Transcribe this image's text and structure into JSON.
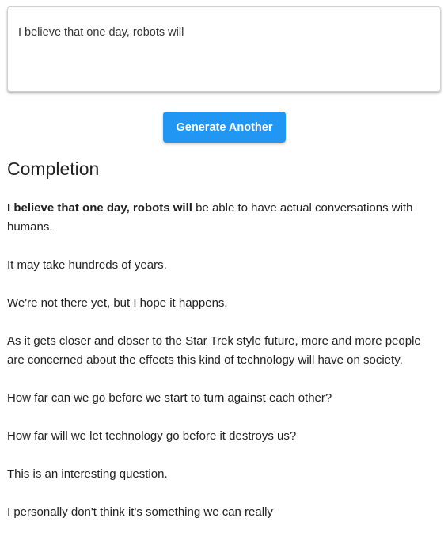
{
  "prompt": {
    "value": "I believe that one day, robots will"
  },
  "generate_button": {
    "label": "Generate Another",
    "color": "#2196f3"
  },
  "completion": {
    "heading": "Completion",
    "prompt_echo": "I believe that one day, robots will",
    "first_continuation": " be able to have actual conversations with humans.",
    "paragraphs": [
      "It may take hundreds of years.",
      "We're not there yet, but I hope it happens.",
      "As it gets closer and closer to the Star Trek style future, more and more people are concerned about the effects this kind of technology will have on society.",
      "How far can we go before we start to turn against each other?",
      "How far will we let technology go before it destroys us?",
      "This is an interesting question.",
      "I personally don't think it's something we can really"
    ]
  }
}
